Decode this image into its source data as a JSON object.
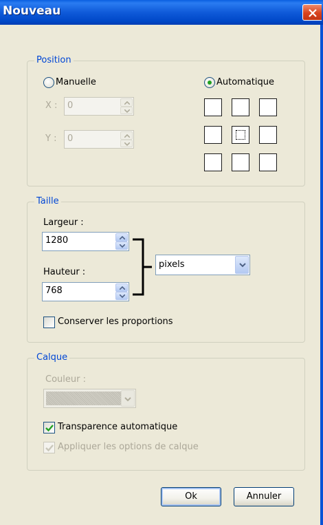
{
  "window": {
    "title": "Nouveau"
  },
  "position": {
    "legend": "Position",
    "manual_label": "Manuelle",
    "auto_label": "Automatique",
    "selected_mode": "Automatique",
    "x_label": "X :",
    "x_value": "0",
    "y_label": "Y :",
    "y_value": "0",
    "anchor_selected": "center"
  },
  "size": {
    "legend": "Taille",
    "width_label": "Largeur :",
    "width_value": "1280",
    "height_label": "Hauteur :",
    "height_value": "768",
    "unit": "pixels",
    "keep_ratio_label": "Conserver les proportions",
    "keep_ratio_checked": false
  },
  "layer": {
    "legend": "Calque",
    "color_label": "Couleur :",
    "auto_transparency_label": "Transparence automatique",
    "auto_transparency_checked": true,
    "apply_options_label": "Appliquer les options de calque",
    "apply_options_checked": true
  },
  "buttons": {
    "ok": "Ok",
    "cancel": "Annuler"
  },
  "colors": {
    "accent": "#0046d5",
    "titlebar": "#0a52d6",
    "check": "#21a121"
  }
}
